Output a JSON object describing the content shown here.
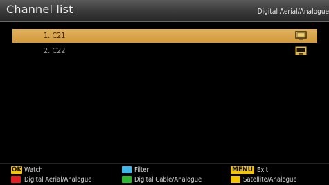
{
  "header": {
    "title": "Channel list",
    "source": "Digital Aerial/Analogue"
  },
  "channels": [
    {
      "label": "1. C21",
      "icon": "tv-icon",
      "selected": true
    },
    {
      "label": "2. C22",
      "icon": "tv-icon",
      "selected": false
    }
  ],
  "footer": {
    "ok": {
      "key": "OK",
      "label": "Watch"
    },
    "blue": {
      "label": "Filter",
      "color": "#3fb6e8"
    },
    "menu": {
      "key": "MENU",
      "label": "Exit"
    },
    "red": {
      "label": "Digital Aerial/Analogue",
      "color": "#e02020"
    },
    "green": {
      "label": "Digital Cable/Analogue",
      "color": "#2fb52f"
    },
    "yellow": {
      "label": "Satellite/Analogue",
      "color": "#f4c400"
    }
  },
  "colors": {
    "selection": "#d9a54a",
    "key_badge": "#f4c400",
    "background": "#000000"
  }
}
